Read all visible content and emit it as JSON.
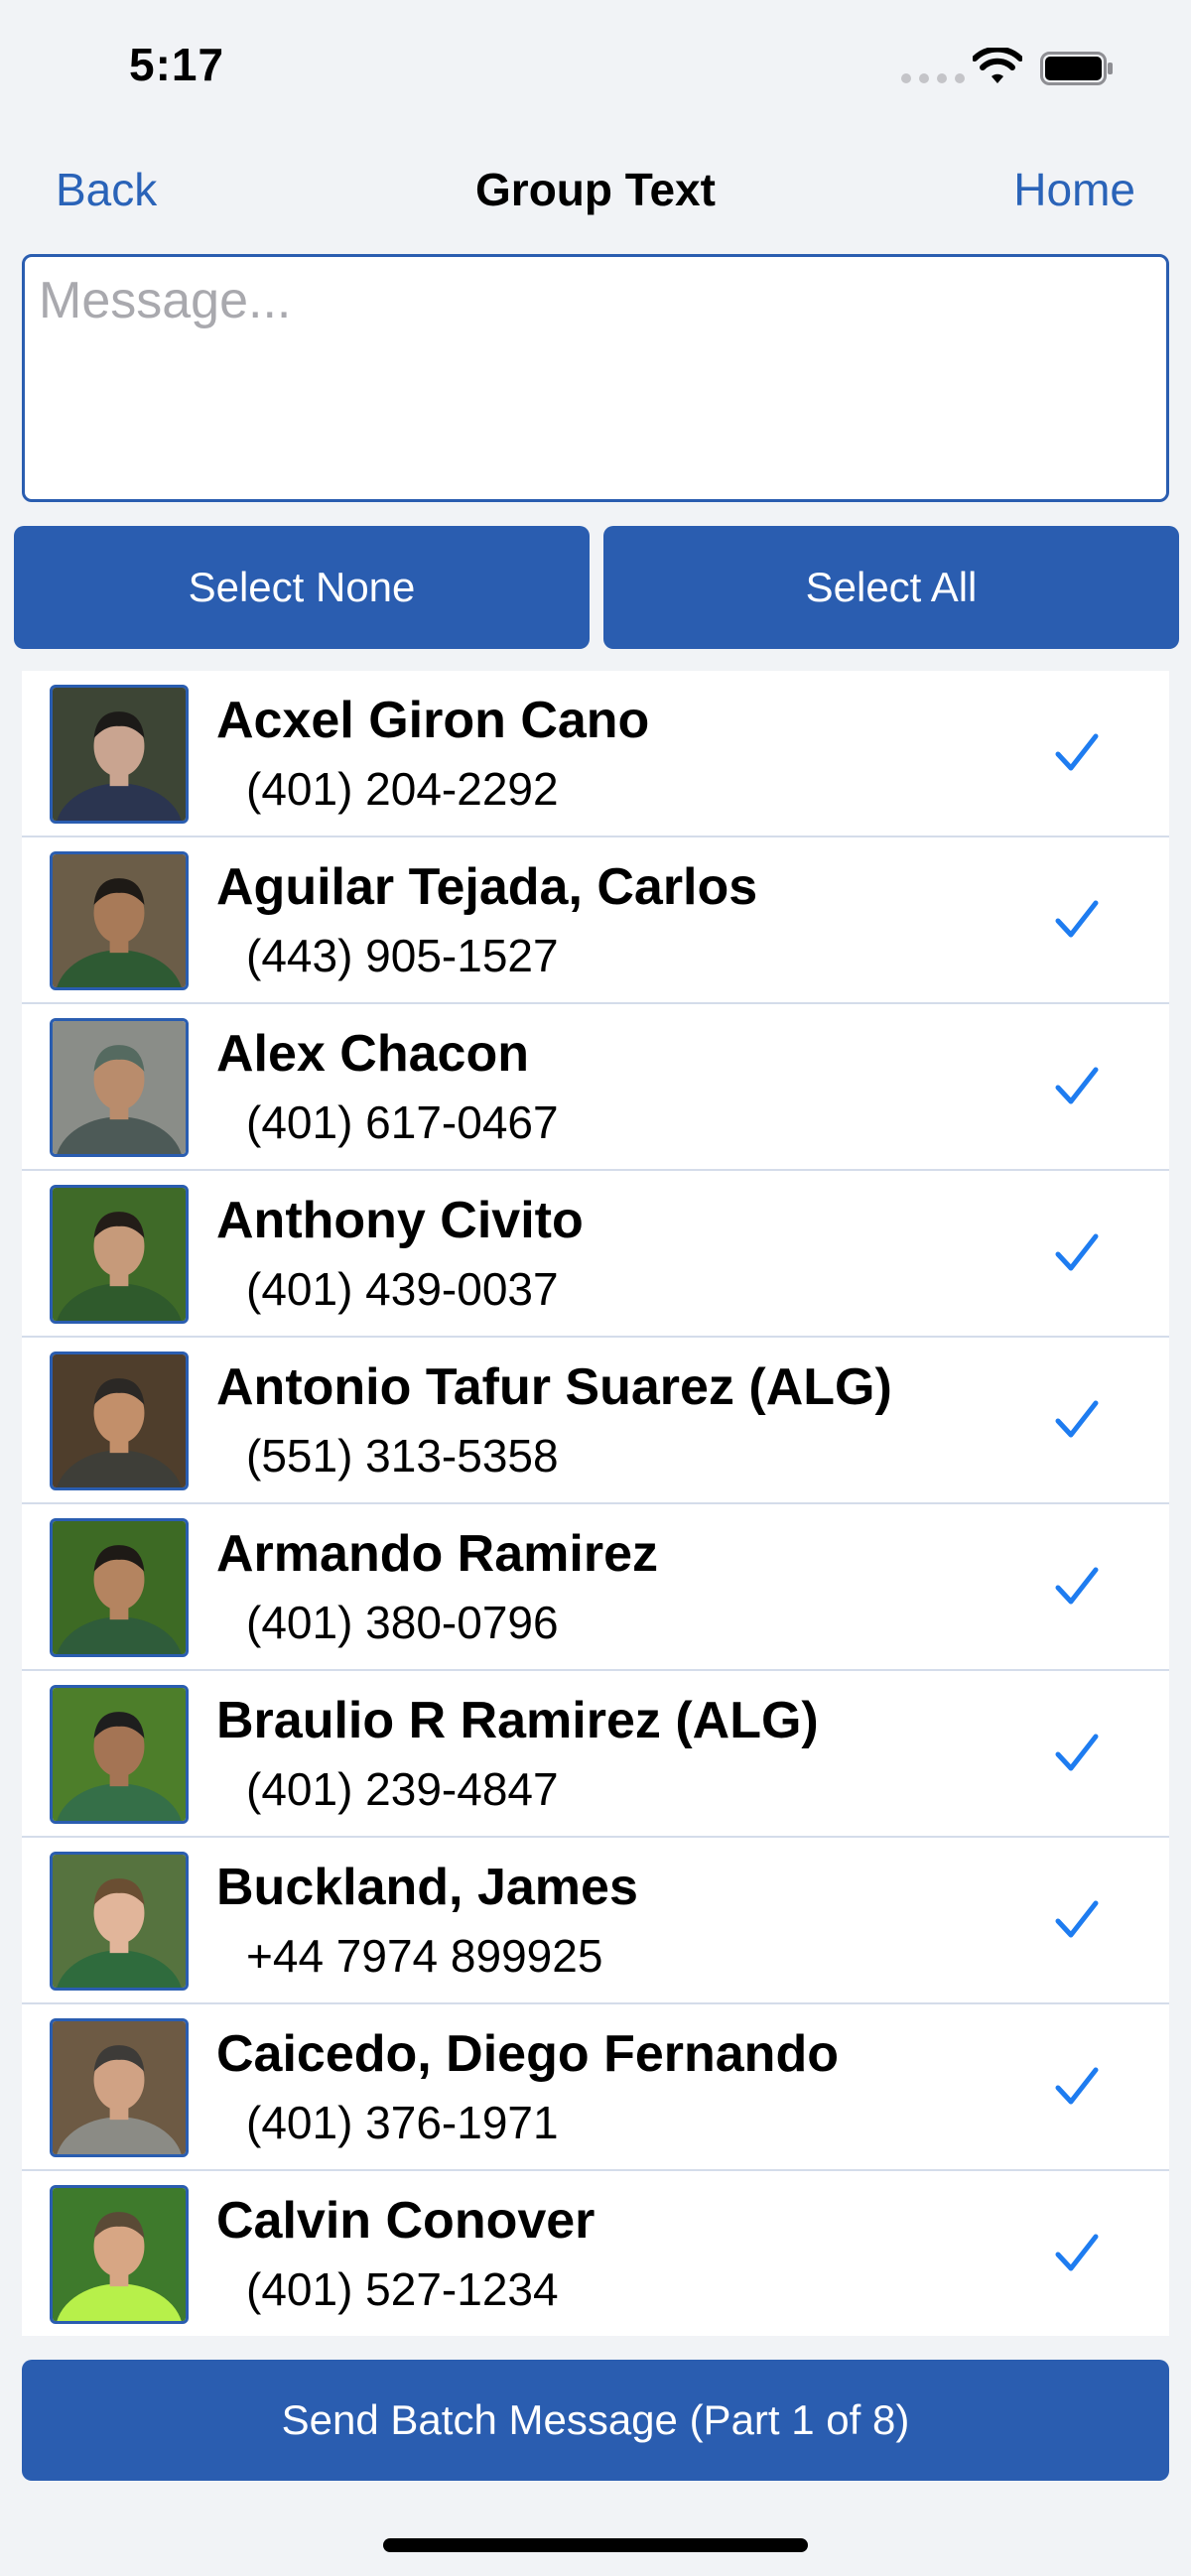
{
  "status_bar": {
    "time": "5:17"
  },
  "nav": {
    "back_label": "Back",
    "title": "Group Text",
    "home_label": "Home"
  },
  "message": {
    "value": "",
    "placeholder": "Message..."
  },
  "actions": {
    "select_none_label": "Select None",
    "select_all_label": "Select All"
  },
  "contacts": [
    {
      "name": "Acxel Giron Cano",
      "phone": "(401) 204-2292",
      "selected": true,
      "bg": "#3d4535",
      "shirt": "#2b3550",
      "skin": "#c9a490",
      "hair": "#1c1a18"
    },
    {
      "name": "Aguilar Tejada, Carlos",
      "phone": "(443) 905-1527",
      "selected": true,
      "bg": "#6b5d48",
      "shirt": "#2e5a33",
      "skin": "#a87a58",
      "hair": "#1e1a16"
    },
    {
      "name": "Alex Chacon",
      "phone": "(401) 617-0467",
      "selected": true,
      "bg": "#8a8d88",
      "shirt": "#4d5a57",
      "skin": "#b98c6c",
      "hair": "#556a60"
    },
    {
      "name": "Anthony Civito",
      "phone": "(401) 439-0037",
      "selected": true,
      "bg": "#3f6a28",
      "shirt": "#2f5a2c",
      "skin": "#c69a7a",
      "hair": "#231d18"
    },
    {
      "name": "Antonio Tafur Suarez (ALG)",
      "phone": "(551) 313-5358",
      "selected": true,
      "bg": "#4f3e2c",
      "shirt": "#3e3e38",
      "skin": "#c28f6a",
      "hair": "#2b2825"
    },
    {
      "name": "Armando Ramirez",
      "phone": "(401) 380-0796",
      "selected": true,
      "bg": "#3d6a24",
      "shirt": "#2f5c3a",
      "skin": "#b48460",
      "hair": "#1e1a16"
    },
    {
      "name": "Braulio R Ramirez (ALG)",
      "phone": "(401) 239-4847",
      "selected": true,
      "bg": "#4d7e2a",
      "shirt": "#356f48",
      "skin": "#a47454",
      "hair": "#1e1e1e"
    },
    {
      "name": "Buckland, James",
      "phone": "+44 7974 899925",
      "selected": true,
      "bg": "#56733f",
      "shirt": "#2f6b3d",
      "skin": "#e1b59a",
      "hair": "#6a4e32"
    },
    {
      "name": "Caicedo, Diego Fernando",
      "phone": "(401) 376-1971",
      "selected": true,
      "bg": "#6d5a44",
      "shirt": "#8b8b85",
      "skin": "#d0a284",
      "hair": "#3d3b38"
    },
    {
      "name": "Calvin Conover",
      "phone": "(401) 527-1234",
      "selected": true,
      "bg": "#3e7a2c",
      "shirt": "#b7f04a",
      "skin": "#d7a684",
      "hair": "#5a4a36"
    }
  ],
  "send": {
    "label": "Send Batch Message (Part 1 of 8)"
  },
  "colors": {
    "accent": "#2a5db0",
    "link": "#2a63b8",
    "check": "#1e7cf0",
    "background": "#f1f3f6"
  }
}
